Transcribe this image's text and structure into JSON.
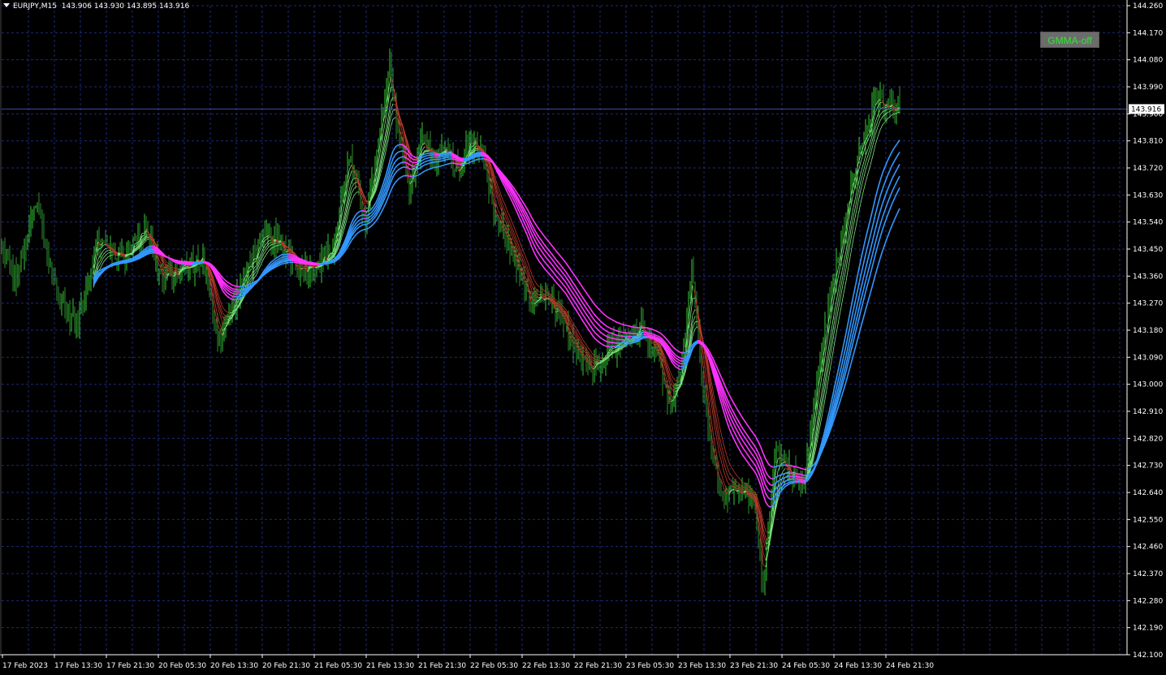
{
  "header": {
    "symbol_timeframe": "EURJPY,M15",
    "ohlc": "143.906 143.930 143.895 143.916"
  },
  "gmma_button": {
    "label": "GMMA-off"
  },
  "colors": {
    "background": "#000000",
    "grid": "#1e2a78",
    "axis": "#ffffff",
    "bull": "#33cc33",
    "bear": "#8b1a1a",
    "short_ma_up": "#7fe37f",
    "short_ma_down": "#c0392b",
    "long_ma_up": "#3399ff",
    "long_ma_down": "#ff33ff",
    "price_line": "#3a4fa8"
  },
  "chart_data": {
    "type": "line",
    "description_free": true,
    "y_axis": {
      "min": 142.1,
      "max": 144.26,
      "ticks": [
        "144.260",
        "144.170",
        "144.080",
        "143.990",
        "143.900",
        "143.810",
        "143.720",
        "143.630",
        "143.540",
        "143.450",
        "143.360",
        "143.270",
        "143.180",
        "143.090",
        "143.000",
        "142.910",
        "142.820",
        "142.730",
        "142.640",
        "142.550",
        "142.460",
        "142.370",
        "142.280",
        "142.190",
        "142.100"
      ],
      "current_price": "143.916"
    },
    "x_axis": {
      "ticks": [
        "17 Feb 2023",
        "17 Feb 13:30",
        "17 Feb 21:30",
        "20 Feb 05:30",
        "20 Feb 13:30",
        "20 Feb 21:30",
        "21 Feb 05:30",
        "21 Feb 13:30",
        "21 Feb 21:30",
        "22 Feb 05:30",
        "22 Feb 13:30",
        "22 Feb 21:30",
        "23 Feb 05:30",
        "23 Feb 13:30",
        "23 Feb 21:30",
        "24 Feb 05:30",
        "24 Feb 13:30",
        "24 Feb 21:30"
      ]
    },
    "grid": true,
    "price_keypoints": [
      [
        0,
        143.46
      ],
      [
        20,
        143.35
      ],
      [
        45,
        143.6
      ],
      [
        70,
        143.3
      ],
      [
        95,
        143.2
      ],
      [
        120,
        143.48
      ],
      [
        150,
        143.42
      ],
      [
        180,
        143.52
      ],
      [
        200,
        143.35
      ],
      [
        225,
        143.38
      ],
      [
        250,
        143.42
      ],
      [
        270,
        143.15
      ],
      [
        290,
        143.28
      ],
      [
        310,
        143.42
      ],
      [
        330,
        143.5
      ],
      [
        350,
        143.45
      ],
      [
        370,
        143.38
      ],
      [
        390,
        143.4
      ],
      [
        410,
        143.45
      ],
      [
        430,
        143.75
      ],
      [
        450,
        143.55
      ],
      [
        465,
        143.78
      ],
      [
        480,
        144.05
      ],
      [
        490,
        143.85
      ],
      [
        505,
        143.65
      ],
      [
        520,
        143.82
      ],
      [
        535,
        143.75
      ],
      [
        550,
        143.78
      ],
      [
        565,
        143.7
      ],
      [
        580,
        143.82
      ],
      [
        595,
        143.75
      ],
      [
        610,
        143.55
      ],
      [
        625,
        143.48
      ],
      [
        640,
        143.38
      ],
      [
        655,
        143.25
      ],
      [
        670,
        143.3
      ],
      [
        690,
        143.22
      ],
      [
        710,
        143.12
      ],
      [
        730,
        143.05
      ],
      [
        750,
        143.12
      ],
      [
        770,
        143.15
      ],
      [
        790,
        143.2
      ],
      [
        810,
        143.1
      ],
      [
        825,
        142.92
      ],
      [
        840,
        143.05
      ],
      [
        852,
        143.38
      ],
      [
        865,
        143.02
      ],
      [
        880,
        142.72
      ],
      [
        895,
        142.62
      ],
      [
        910,
        142.65
      ],
      [
        930,
        142.6
      ],
      [
        940,
        142.32
      ],
      [
        955,
        142.78
      ],
      [
        970,
        142.72
      ],
      [
        990,
        142.65
      ],
      [
        1005,
        142.98
      ],
      [
        1020,
        143.25
      ],
      [
        1035,
        143.45
      ],
      [
        1050,
        143.7
      ],
      [
        1065,
        143.82
      ],
      [
        1080,
        143.95
      ],
      [
        1095,
        143.92
      ],
      [
        1108,
        143.916
      ]
    ],
    "ma_start_index": 115,
    "short_periods": [
      3,
      5,
      8,
      10,
      12,
      15
    ],
    "long_periods": [
      30,
      35,
      40,
      45,
      50,
      60
    ],
    "last_candle_index": 1108
  }
}
